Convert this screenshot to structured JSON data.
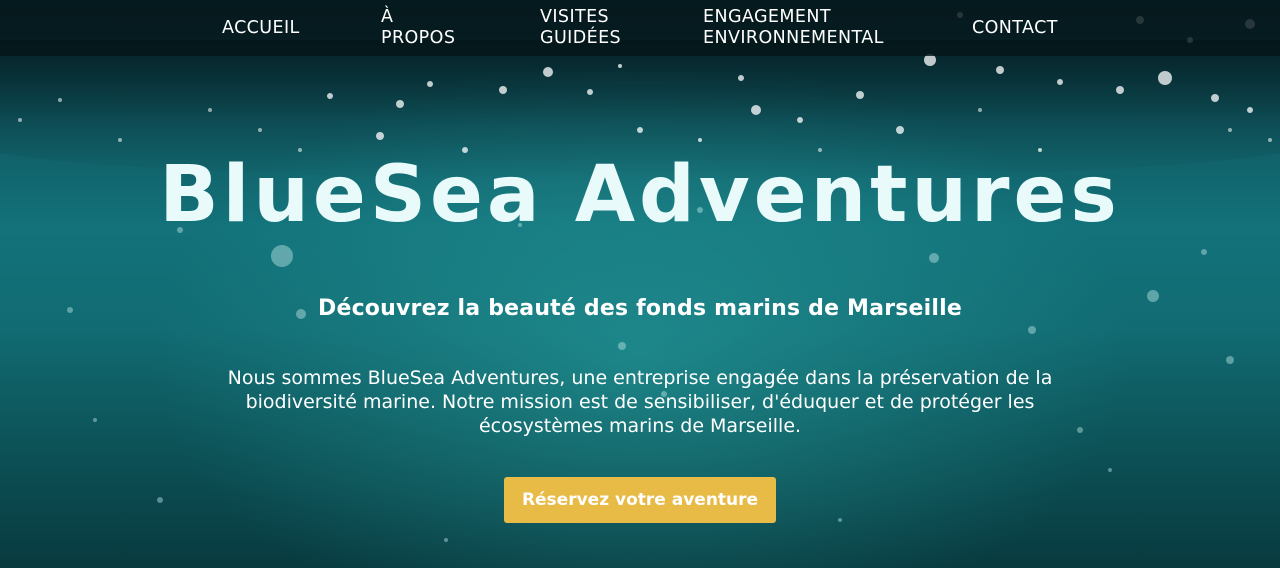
{
  "nav": {
    "items": [
      {
        "line1": "ACCUEIL",
        "line2": ""
      },
      {
        "line1": "À",
        "line2": "PROPOS"
      },
      {
        "line1": "VISITES",
        "line2": "GUIDÉES"
      },
      {
        "line1": "ENGAGEMENT",
        "line2": "ENVIRONNEMENTAL"
      },
      {
        "line1": "CONTACT",
        "line2": ""
      }
    ]
  },
  "hero": {
    "logo_text": "BlueSea Adventures",
    "subtitle": "Découvrez la beauté des fonds marins de Marseille",
    "intro": "Nous sommes BlueSea Adventures, une entreprise engagée dans la préservation de la biodiversité marine. Notre mission est de sensibiliser, d'éduquer et de protéger les écosystèmes marins de Marseille.",
    "cta_label": "Réservez votre aventure",
    "background_image": "underwater-surface-with-bubbles"
  },
  "colors": {
    "nav_background": "#05161a",
    "water": "#13727a",
    "cta": "#e7bb45",
    "text": "#ffffff"
  }
}
